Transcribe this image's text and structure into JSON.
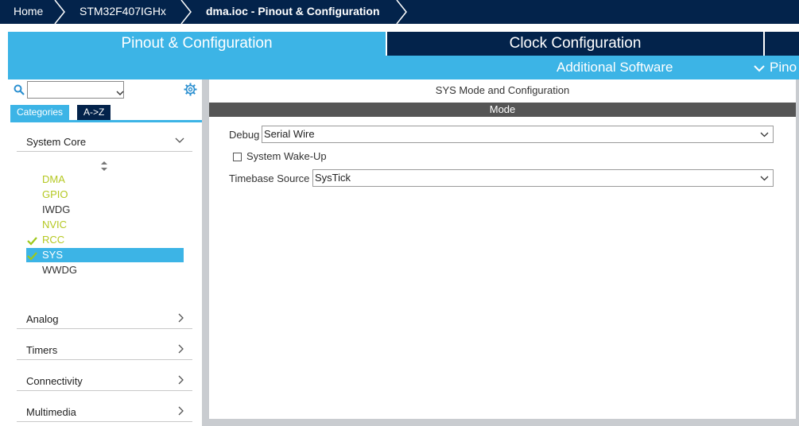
{
  "breadcrumb": {
    "items": [
      {
        "label": "Home"
      },
      {
        "label": "STM32F407IGHx"
      },
      {
        "label": "dma.ioc - Pinout & Configuration"
      }
    ]
  },
  "tabs": {
    "pinout": "Pinout & Configuration",
    "clock": "Clock Configuration"
  },
  "subbar": {
    "additional_software": "Additional Software",
    "pinout_truncated": "Pino"
  },
  "left_panel": {
    "search_value": "",
    "tab_categories": "Categories",
    "tab_az": "A->Z",
    "system_core": "System Core",
    "peripherals": [
      {
        "label": "DMA",
        "state": "configured"
      },
      {
        "label": "GPIO",
        "state": "configured"
      },
      {
        "label": "IWDG",
        "state": "none"
      },
      {
        "label": "NVIC",
        "state": "configured"
      },
      {
        "label": "RCC",
        "state": "checked"
      },
      {
        "label": "SYS",
        "state": "selected-checked"
      },
      {
        "label": "WWDG",
        "state": "none"
      }
    ],
    "sections": [
      {
        "label": "Analog"
      },
      {
        "label": "Timers"
      },
      {
        "label": "Connectivity"
      },
      {
        "label": "Multimedia"
      }
    ]
  },
  "right_panel": {
    "title": "SYS Mode and Configuration",
    "mode_header": "Mode",
    "debug_label": "Debug",
    "debug_value": "Serial Wire",
    "wakeup_label": "System Wake-Up",
    "wakeup_checked": false,
    "timebase_label": "Timebase Source",
    "timebase_value": "SysTick"
  },
  "colors": {
    "dark_navy": "#03234b",
    "accent_blue": "#3cb4e6",
    "configured_yellow": "#b5c822",
    "check_green": "#9ec81a",
    "mode_bar": "#555555"
  }
}
